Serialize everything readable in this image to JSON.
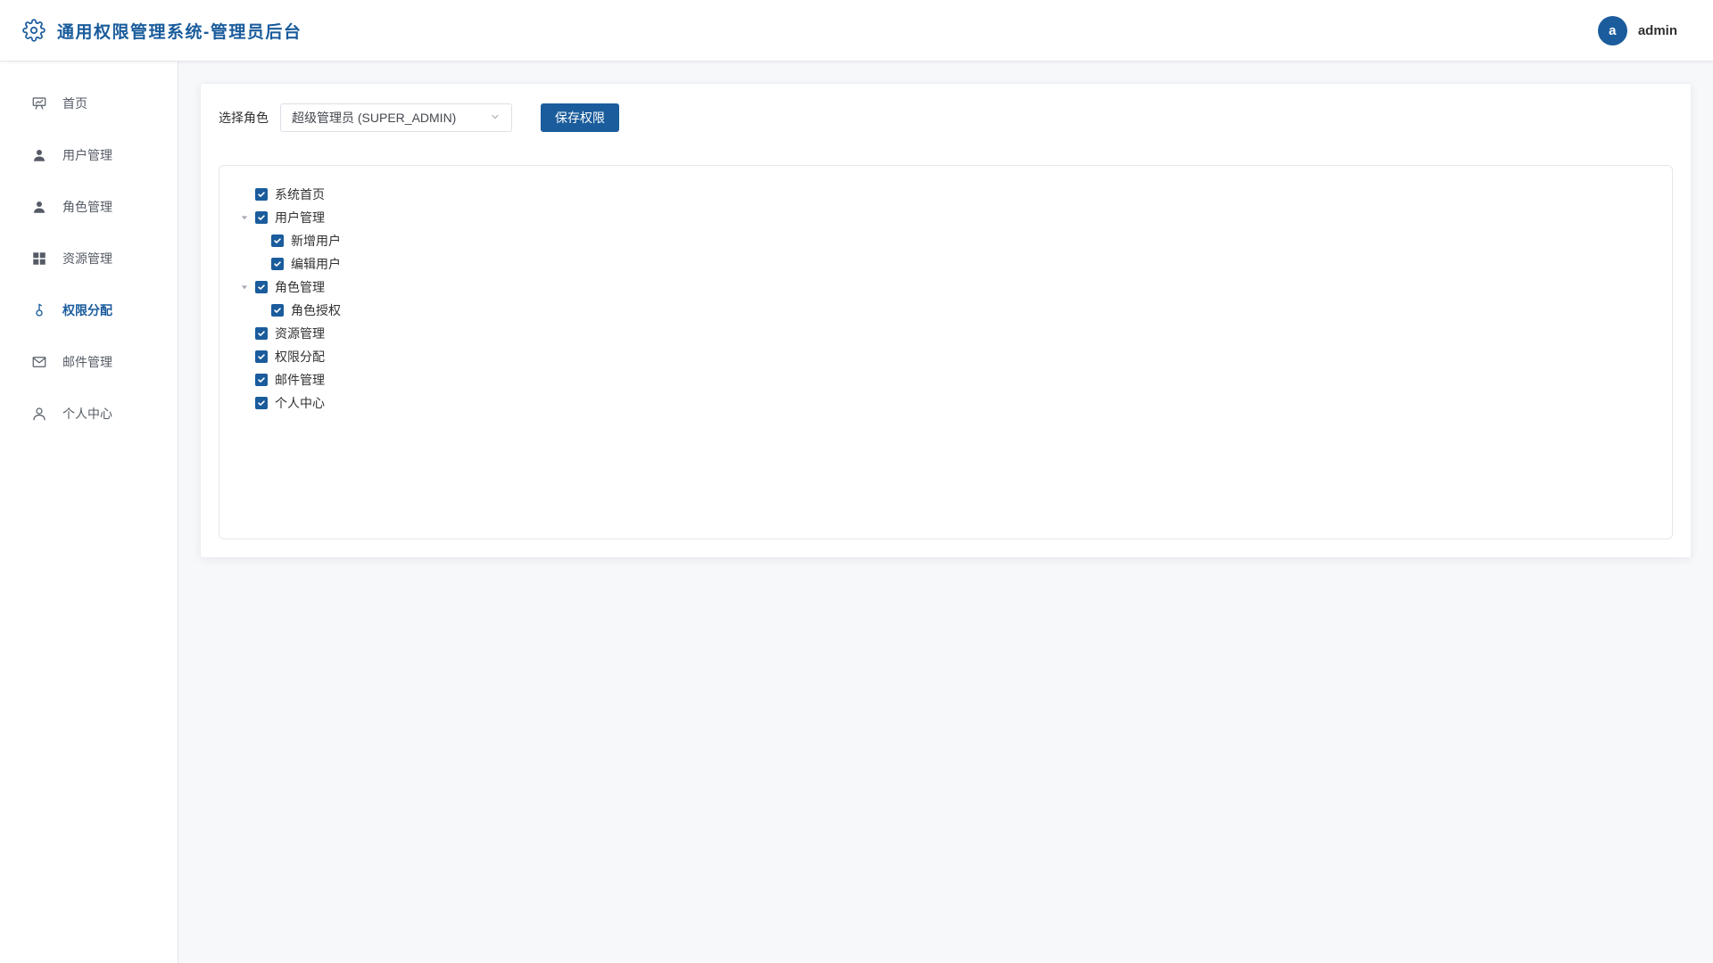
{
  "header": {
    "title": "通用权限管理系统-管理员后台",
    "user": {
      "avatar_letter": "a",
      "name": "admin"
    }
  },
  "sidebar": {
    "items": [
      {
        "label": "首页",
        "icon": "presentation-icon",
        "active": false
      },
      {
        "label": "用户管理",
        "icon": "user-icon",
        "active": false
      },
      {
        "label": "角色管理",
        "icon": "user-role-icon",
        "active": false
      },
      {
        "label": "资源管理",
        "icon": "grid-icon",
        "active": false
      },
      {
        "label": "权限分配",
        "icon": "key-icon",
        "active": true
      },
      {
        "label": "邮件管理",
        "icon": "mail-icon",
        "active": false
      },
      {
        "label": "个人中心",
        "icon": "user-outline-icon",
        "active": false
      }
    ]
  },
  "main": {
    "role_select": {
      "label": "选择角色",
      "value": "超级管理员 (SUPER_ADMIN)"
    },
    "save_button": "保存权限",
    "tree": [
      {
        "label": "系统首页",
        "checked": true
      },
      {
        "label": "用户管理",
        "checked": true,
        "expanded": true,
        "children": [
          {
            "label": "新增用户",
            "checked": true
          },
          {
            "label": "编辑用户",
            "checked": true
          }
        ]
      },
      {
        "label": "角色管理",
        "checked": true,
        "expanded": true,
        "children": [
          {
            "label": "角色授权",
            "checked": true
          }
        ]
      },
      {
        "label": "资源管理",
        "checked": true
      },
      {
        "label": "权限分配",
        "checked": true
      },
      {
        "label": "邮件管理",
        "checked": true
      },
      {
        "label": "个人中心",
        "checked": true
      }
    ]
  },
  "colors": {
    "primary": "#1a5c9c",
    "background": "#f7f8fa"
  }
}
